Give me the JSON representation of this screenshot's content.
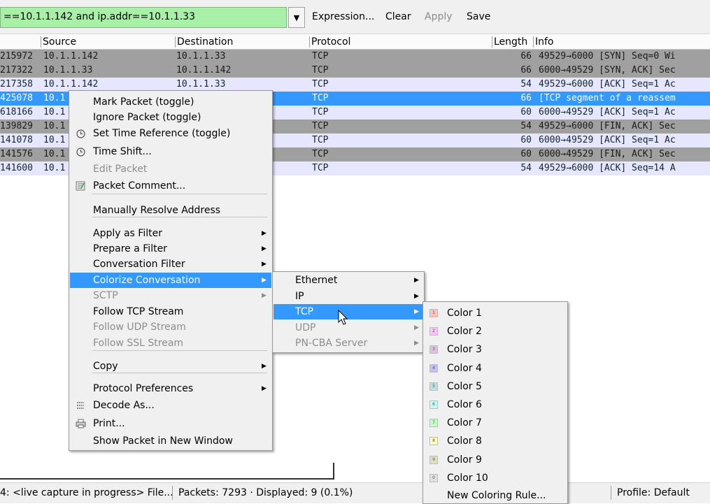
{
  "filter_toolbar": {
    "filter_text": "==10.1.1.142 and ip.addr==10.1.1.33",
    "expression_label": "Expression...",
    "clear_label": "Clear",
    "apply_label": "Apply",
    "save_label": "Save",
    "filter_bg_color": "#a8f0a8"
  },
  "packet_list": {
    "columns": [
      "Source",
      "Destination",
      "Protocol",
      "Length",
      "Info"
    ],
    "rows": [
      {
        "time": "215972",
        "source": "10.1.1.142",
        "destination": "10.1.1.33",
        "protocol": "TCP",
        "length": "66",
        "info": "49529→6000 [SYN] Seq=0 Wi",
        "bg": "#a0a0a0",
        "fg": "#1a1a1a"
      },
      {
        "time": "217322",
        "source": "10.1.1.33",
        "destination": "10.1.1.142",
        "protocol": "TCP",
        "length": "66",
        "info": "6000→49529 [SYN, ACK] Sec",
        "bg": "#a0a0a0",
        "fg": "#1a1a1a"
      },
      {
        "time": "217358",
        "source": "10.1.1.142",
        "destination": "10.1.1.33",
        "protocol": "TCP",
        "length": "54",
        "info": "49529→6000 [ACK] Seq=1 Ac",
        "bg": "#e7e6ff",
        "fg": "#12272e"
      },
      {
        "time": "425078",
        "source": "10.1",
        "destination": "",
        "protocol": "TCP",
        "length": "66",
        "info": "[TCP segment of a reassem",
        "bg": "#3399ff",
        "fg": "#ffffff"
      },
      {
        "time": "618166",
        "source": "10.1",
        "destination": "",
        "protocol": "TCP",
        "length": "60",
        "info": "6000→49529 [ACK] Seq=1 Ac",
        "bg": "#e7e6ff",
        "fg": "#12272e"
      },
      {
        "time": "139829",
        "source": "10.1",
        "destination": "",
        "protocol": "TCP",
        "length": "54",
        "info": "49529→6000 [FIN, ACK] Sec",
        "bg": "#a0a0a0",
        "fg": "#1a1a1a"
      },
      {
        "time": "141078",
        "source": "10.1",
        "destination": "",
        "protocol": "TCP",
        "length": "60",
        "info": "6000→49529 [ACK] Seq=1 Ac",
        "bg": "#e7e6ff",
        "fg": "#12272e"
      },
      {
        "time": "141576",
        "source": "10.1",
        "destination": "",
        "protocol": "TCP",
        "length": "60",
        "info": "6000→49529 [FIN, ACK] Sec",
        "bg": "#a0a0a0",
        "fg": "#1a1a1a"
      },
      {
        "time": "141600",
        "source": "10.1",
        "destination": "",
        "protocol": "TCP",
        "length": "54",
        "info": "49529→6000 [ACK] Seq=14 A",
        "bg": "#e7e6ff",
        "fg": "#12272e"
      }
    ]
  },
  "context_menu": {
    "items": [
      {
        "label": "Mark Packet (toggle)",
        "icon": "",
        "disabled": false,
        "submenu": false,
        "selected": false
      },
      {
        "label": "Ignore Packet (toggle)",
        "icon": "",
        "disabled": false,
        "submenu": false,
        "selected": false
      },
      {
        "label": "Set Time Reference (toggle)",
        "icon": "clock-icon",
        "disabled": false,
        "submenu": false,
        "selected": false
      },
      {
        "label": "Time Shift...",
        "icon": "clock-icon",
        "disabled": false,
        "submenu": false,
        "selected": false
      },
      {
        "label": "Edit Packet",
        "icon": "",
        "disabled": true,
        "submenu": false,
        "selected": false
      },
      {
        "label": "Packet Comment...",
        "icon": "comment-icon",
        "disabled": false,
        "submenu": false,
        "selected": false
      },
      {
        "label": "Manually Resolve Address",
        "icon": "",
        "disabled": false,
        "submenu": false,
        "selected": false
      },
      {
        "label": "Apply as Filter",
        "icon": "",
        "disabled": false,
        "submenu": true,
        "selected": false
      },
      {
        "label": "Prepare a Filter",
        "icon": "",
        "disabled": false,
        "submenu": true,
        "selected": false
      },
      {
        "label": "Conversation Filter",
        "icon": "",
        "disabled": false,
        "submenu": true,
        "selected": false
      },
      {
        "label": "Colorize Conversation",
        "icon": "",
        "disabled": false,
        "submenu": true,
        "selected": true
      },
      {
        "label": "SCTP",
        "icon": "",
        "disabled": true,
        "submenu": true,
        "selected": false
      },
      {
        "label": "Follow TCP Stream",
        "icon": "",
        "disabled": false,
        "submenu": false,
        "selected": false
      },
      {
        "label": "Follow UDP Stream",
        "icon": "",
        "disabled": true,
        "submenu": false,
        "selected": false
      },
      {
        "label": "Follow SSL Stream",
        "icon": "",
        "disabled": true,
        "submenu": false,
        "selected": false
      },
      {
        "label": "Copy",
        "icon": "",
        "disabled": false,
        "submenu": true,
        "selected": false
      },
      {
        "label": "Protocol Preferences",
        "icon": "",
        "disabled": false,
        "submenu": true,
        "selected": false
      },
      {
        "label": "Decode As...",
        "icon": "decode-icon",
        "disabled": false,
        "submenu": false,
        "selected": false
      },
      {
        "label": "Print...",
        "icon": "printer-icon",
        "disabled": false,
        "submenu": false,
        "selected": false
      },
      {
        "label": "Show Packet in New Window",
        "icon": "",
        "disabled": false,
        "submenu": false,
        "selected": false
      }
    ]
  },
  "colorize_submenu": {
    "items": [
      {
        "label": "Ethernet",
        "disabled": false,
        "submenu": true,
        "selected": false
      },
      {
        "label": "IP",
        "disabled": false,
        "submenu": true,
        "selected": false
      },
      {
        "label": "TCP",
        "disabled": false,
        "submenu": true,
        "selected": true
      },
      {
        "label": "UDP",
        "disabled": true,
        "submenu": true,
        "selected": false
      },
      {
        "label": "PN-CBA Server",
        "disabled": true,
        "submenu": true,
        "selected": false
      }
    ]
  },
  "color_submenu": {
    "items": [
      {
        "label": "Color 1",
        "swatch_num": "1",
        "swatch_color": "#ffc0c0"
      },
      {
        "label": "Color 2",
        "swatch_num": "2",
        "swatch_color": "#ffc0ff"
      },
      {
        "label": "Color 3",
        "swatch_num": "3",
        "swatch_color": "#e0c0e0"
      },
      {
        "label": "Color 4",
        "swatch_num": "4",
        "swatch_color": "#c0c0ff"
      },
      {
        "label": "Color 5",
        "swatch_num": "5",
        "swatch_color": "#c0e0e0"
      },
      {
        "label": "Color 6",
        "swatch_num": "6",
        "swatch_color": "#c0ffff"
      },
      {
        "label": "Color 7",
        "swatch_num": "7",
        "swatch_color": "#c0ffc0"
      },
      {
        "label": "Color 8",
        "swatch_num": "8",
        "swatch_color": "#ffffc0"
      },
      {
        "label": "Color 9",
        "swatch_num": "9",
        "swatch_color": "#e0e0c0"
      },
      {
        "label": "Color 10",
        "swatch_num": "0",
        "swatch_color": "#e0e0e0"
      }
    ],
    "new_rule_label": "New Coloring Rule..."
  },
  "status_bar": {
    "file_text": "4: <live capture in progress> File...",
    "packets_text": "Packets: 7293 · Displayed: 9 (0.1%)",
    "profile_text": "Profile: Default"
  }
}
